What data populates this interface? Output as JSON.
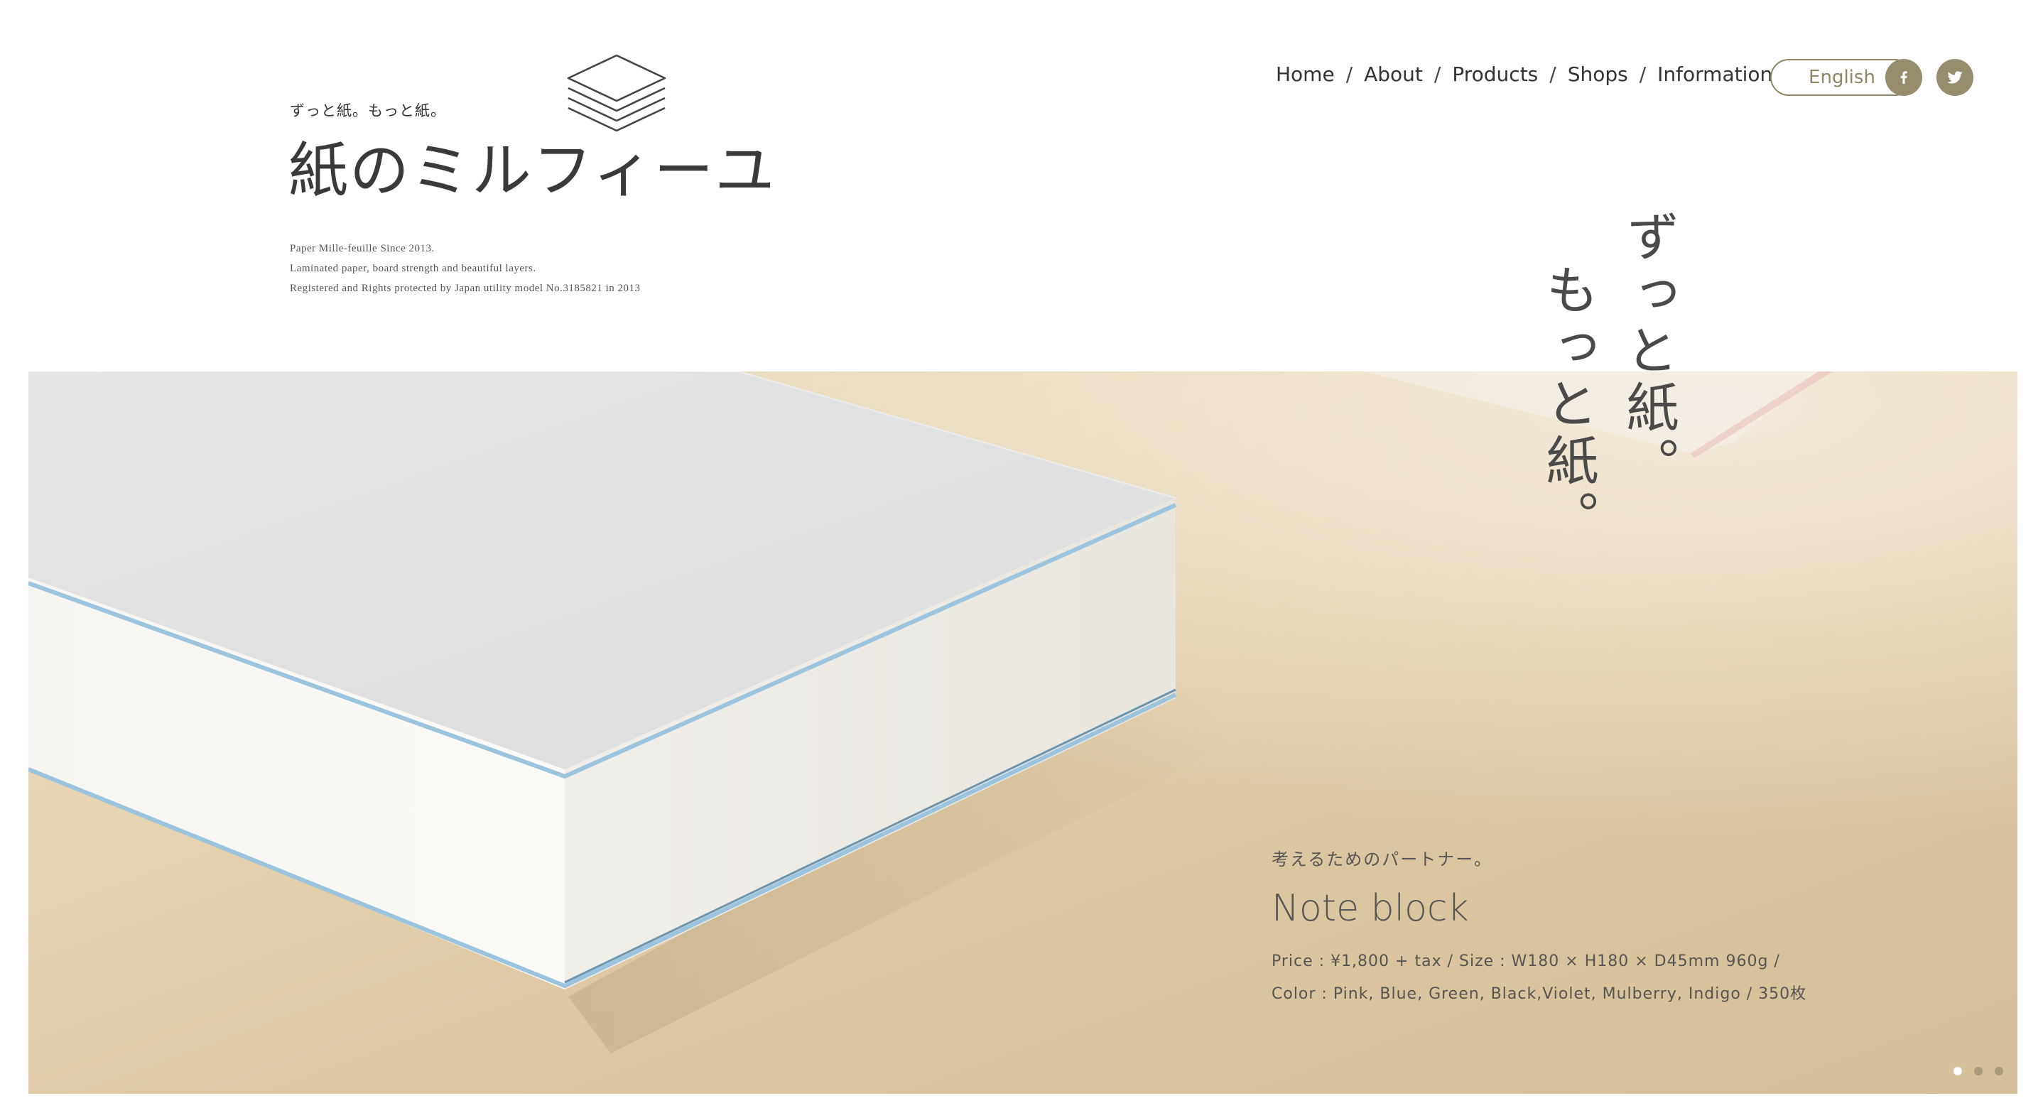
{
  "brand": {
    "tagline": "ずっと紙。もっと紙。",
    "name": "紙のミルフィーユ",
    "description": [
      "Paper Mille-feuille Since 2013.",
      "Laminated paper, board strength and beautiful layers.",
      "Registered and Rights protected by Japan utility model No.3185821 in 2013"
    ],
    "logo_icon": "paper-stack-icon"
  },
  "nav": {
    "items": [
      "Home",
      "About",
      "Products",
      "Shops",
      "Information"
    ],
    "separator": "/",
    "language_button": "English",
    "social": [
      {
        "name": "facebook-icon",
        "glyph": "f"
      },
      {
        "name": "twitter-icon",
        "glyph": "t"
      }
    ]
  },
  "hero": {
    "catchphrase": [
      "ずっと紙。",
      "もっと紙。"
    ],
    "product": {
      "subtitle": "考えるためのパートナー。",
      "name": "Note block",
      "spec_line1": "Price : ¥1,800 + tax / Size : W180 × H180 × D45mm 960g /",
      "spec_line2": "Color : Pink, Blue, Green, Black,Violet, Mulberry, Indigo / 350枚"
    },
    "slider": {
      "count": 3,
      "active_index": 0
    }
  },
  "colors": {
    "accent": "#968c6e",
    "text": "#333333",
    "hero_background": "#e2d1ae",
    "paper_edge_blue": "#9cc4dc"
  }
}
